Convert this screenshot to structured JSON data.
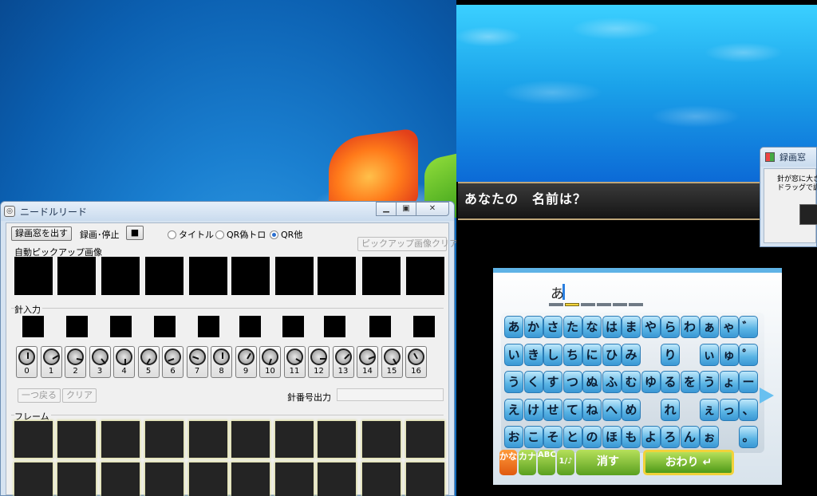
{
  "app": {
    "title": "ニードルリード",
    "controls": {
      "record_window_button": "録画窓を出す",
      "record_toggle_label": "録画･停止",
      "record_toggle_state": "■",
      "radio_options": [
        "タイトル",
        "QR偽トロ",
        "QR他"
      ],
      "radio_selected": 2,
      "clear_pickup_button": "ピックアップ画像クリア"
    },
    "auto_pickup_label": "自動ピックアップ画像",
    "needle_input_label": "針入力",
    "dial_numbers": [
      "0",
      "1",
      "2",
      "3",
      "4",
      "5",
      "6",
      "7",
      "8",
      "9",
      "10",
      "11",
      "12",
      "13",
      "14",
      "15",
      "16"
    ],
    "undo_button": "一つ戻る",
    "clear_button": "クリア",
    "needle_output_label": "針番号出力",
    "needle_output_value": "",
    "frame_label": "フレーム"
  },
  "game": {
    "dialog_text": "あなたの　名前は？",
    "entry_text": "あ",
    "rows": [
      [
        "あ",
        "か",
        "さ",
        "た",
        "な",
        "は",
        "ま",
        "や",
        "ら",
        "わ",
        "ぁ",
        "ゃ",
        "゛"
      ],
      [
        "い",
        "き",
        "し",
        "ち",
        "に",
        "ひ",
        "み",
        "",
        "り",
        "",
        "ぃ",
        "ゅ",
        "゜"
      ],
      [
        "う",
        "く",
        "す",
        "つ",
        "ぬ",
        "ふ",
        "む",
        "ゆ",
        "る",
        "を",
        "う",
        "ょ",
        "ー"
      ],
      [
        "え",
        "け",
        "せ",
        "て",
        "ね",
        "へ",
        "め",
        "",
        "れ",
        "",
        "ぇ",
        "っ",
        "、"
      ],
      [
        "お",
        "こ",
        "そ",
        "と",
        "の",
        "ほ",
        "も",
        "よ",
        "ろ",
        "ん",
        "ぉ",
        "",
        "。"
      ]
    ],
    "mode_kana": "かな",
    "mode_katakana": "カナ",
    "mode_abc": "ABC",
    "mode_symbol": "1/♪",
    "delete_label": "消す",
    "finish_label": "おわり ↵"
  },
  "rec_window": {
    "title": "録画窓",
    "message_line1": "針が窓に大き",
    "message_line2": "ドラッグで調節"
  }
}
